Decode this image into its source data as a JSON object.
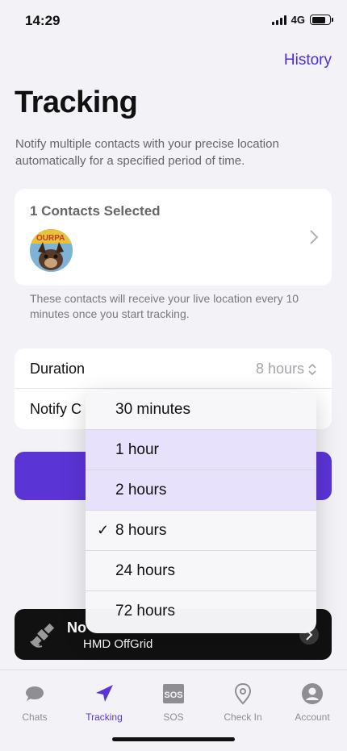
{
  "status": {
    "time": "14:29",
    "network": "4G"
  },
  "header": {
    "history_label": "History",
    "title": "Tracking",
    "description": "Notify multiple contacts with your precise location automatically for a specified period of time."
  },
  "contacts": {
    "title": "1 Contacts Selected",
    "note": "These contacts will receive your live location every 10 minutes once you start tracking."
  },
  "settings": {
    "duration_label": "Duration",
    "duration_value": "8 hours",
    "notify_label": "Notify C"
  },
  "dropdown": {
    "options": [
      {
        "label": "30 minutes",
        "checked": false
      },
      {
        "label": "1 hour",
        "checked": false
      },
      {
        "label": "2 hours",
        "checked": false
      },
      {
        "label": "8 hours",
        "checked": true
      },
      {
        "label": "24 hours",
        "checked": false
      },
      {
        "label": "72 hours",
        "checked": false
      }
    ],
    "check_glyph": "✓"
  },
  "banner": {
    "title": "No",
    "subtitle": "HMD OffGrid",
    "icon": "satellite-icon"
  },
  "tabs": [
    {
      "label": "Chats",
      "icon": "chat-bubble-icon"
    },
    {
      "label": "Tracking",
      "icon": "navigation-arrow-icon",
      "active": true
    },
    {
      "label": "SOS",
      "icon": "sos-icon"
    },
    {
      "label": "Check In",
      "icon": "location-pin-icon"
    },
    {
      "label": "Account",
      "icon": "account-icon"
    }
  ],
  "colors": {
    "accent": "#5b34d6",
    "link": "#4f2bd6",
    "highlight": "#e8e1fb"
  }
}
